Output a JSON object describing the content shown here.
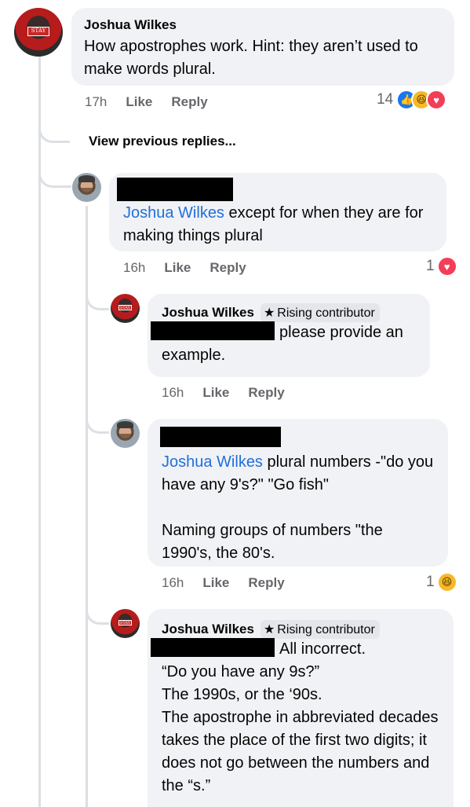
{
  "thread": {
    "comment1": {
      "author": "Joshua Wilkes",
      "text": "How apostrophes work. Hint: they aren’t used to make words plural.",
      "time": "17h",
      "like": "Like",
      "reply": "Reply",
      "reaction_count": "14"
    },
    "view_previous": "View previous replies...",
    "comment2": {
      "mention": "Joshua Wilkes",
      "text": " except for when they are for making things plural",
      "time": "16h",
      "like": "Like",
      "reply": "Reply",
      "reaction_count": "1"
    },
    "comment3": {
      "author": "Joshua Wilkes",
      "badge": "Rising contributor",
      "text": "please provide an example.",
      "time": "16h",
      "like": "Like",
      "reply": "Reply"
    },
    "comment4": {
      "mention": "Joshua Wilkes",
      "text": " plural numbers -\"do you have any 9's?\" \"Go fish\"",
      "text2": "Naming groups of numbers \"the 1990's, the 80's.",
      "time": "16h",
      "like": "Like",
      "reply": "Reply",
      "reaction_count": "1"
    },
    "comment5": {
      "author": "Joshua Wilkes",
      "badge": "Rising contributor",
      "line1": "All incorrect.",
      "line2": "“Do you have any 9s?”",
      "line3": "The 1990s, or the ‘90s.",
      "line4": "The apostrophe in abbreviated decades takes the place of the first two digits; it does not go between the numbers and the “s.”"
    }
  },
  "colors": {
    "link": "#216fdb",
    "bubble": "#f0f2f5",
    "meta": "#65676b"
  }
}
